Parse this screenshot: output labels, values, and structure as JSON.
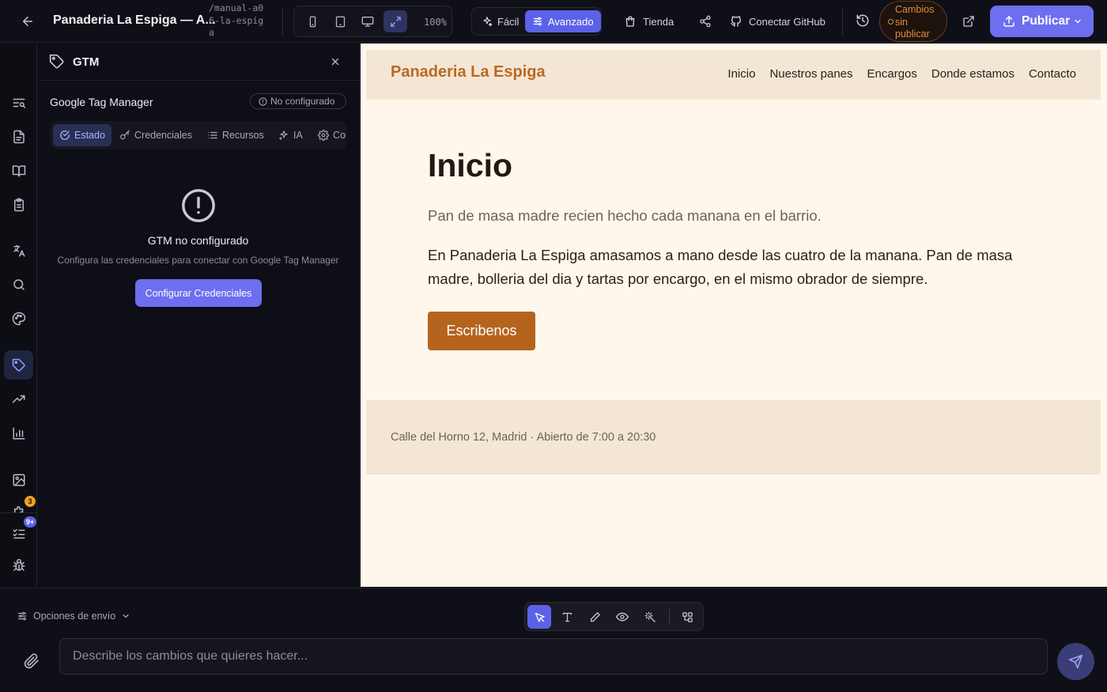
{
  "topbar": {
    "project_title": "Panaderia La Espiga — A...",
    "project_slug": "/manual-a06-la-espiga",
    "zoom": "100%",
    "modes": [
      "Fácil",
      "Avanzado"
    ],
    "active_mode": "Avanzado",
    "store_label": "Tienda",
    "github_label": "Conectar GitHub",
    "unpublished_label": "Cambios sin publicar",
    "publish_label": "Publicar",
    "colors": {
      "accent": "#6d6ef0",
      "warning": "#e58a3c"
    }
  },
  "rail": {
    "badges": {
      "extensions": "3",
      "tasks": "9+"
    },
    "active_item": "tags"
  },
  "panel": {
    "title": "GTM",
    "service_title": "Google Tag Manager",
    "status": "No configurado",
    "tabs": [
      "Estado",
      "Credenciales",
      "Recursos",
      "IA",
      "Configuración"
    ],
    "active_tab": "Estado",
    "empty_title": "GTM no configurado",
    "empty_subtitle": "Configura las credenciales para conectar con Google Tag Manager",
    "config_button": "Configurar Credenciales"
  },
  "preview": {
    "logo": "Panaderia La Espiga",
    "nav": [
      "Inicio",
      "Nuestros panes",
      "Encargos",
      "Donde estamos",
      "Contacto"
    ],
    "hero_title": "Inicio",
    "hero_subtitle": "Pan de masa madre recien hecho cada manana en el barrio.",
    "hero_body": "En Panaderia La Espiga amasamos a mano desde las cuatro de la manana. Pan de masa madre, bolleria del dia y tartas por encargo, en el mismo obrador de siempre.",
    "cta_label": "Escribenos",
    "footer_text": "Calle del Horno 12, Madrid · Abierto de 7:00 a 20:30",
    "colors": {
      "brand": "#b86a22",
      "background": "#fff7ec",
      "band": "#f4e6d4"
    }
  },
  "chat": {
    "send_options_label": "Opciones de envío",
    "input_placeholder": "Describe los cambios que quieres hacer..."
  }
}
